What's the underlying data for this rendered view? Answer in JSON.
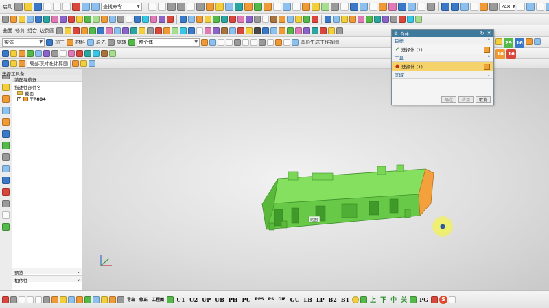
{
  "toolbar1": {
    "menu_label": "启动",
    "command_search_placeholder": "查找命令",
    "zoom_value": "248"
  },
  "toolbar2": {
    "text_items": []
  },
  "toolbar3": {
    "labels": [
      "曲面",
      "修剪",
      "组合",
      "边倒圆"
    ]
  },
  "toolbar4": {
    "selection_filter": "实体",
    "selection_scope": "整个体",
    "labels": [
      "加工",
      "材料",
      "原先",
      "旋转"
    ],
    "right_text": "圆形生成工作视图"
  },
  "toolbar6": {
    "label": "局部项对准计算图"
  },
  "navigator": {
    "header": "选择工具条",
    "title": "装配导航器",
    "root": "描述性部件名",
    "items": [
      {
        "label": "截面",
        "checked": false
      },
      {
        "label": "TP004",
        "checked": true
      }
    ],
    "bottom_rows": [
      "预览",
      "相依性"
    ]
  },
  "dialog": {
    "title": "合并",
    "target_section": "目标",
    "target_select": "选择体 (1)",
    "tool_section": "工具",
    "tool_select": "选择体 (1)",
    "region_section": "区域",
    "buttons": {
      "ok": "确定",
      "apply": "应用",
      "cancel": "取消"
    }
  },
  "viewport": {
    "part_label": "贴图"
  },
  "right_strip": {
    "numbers": [
      "29",
      "16",
      "16",
      "16"
    ]
  },
  "bottombar": {
    "commands": [
      "U1",
      "U2",
      "UP",
      "UB",
      "PH",
      "PU",
      "PPS",
      "PS",
      "DIE",
      "GU",
      "LB",
      "LP",
      "B2",
      "B1"
    ],
    "small_labels": [
      "导出",
      "修正",
      "工程图"
    ],
    "cn_chars": [
      "上",
      "下",
      "中",
      "关"
    ],
    "tail": "PG"
  },
  "colors": {
    "part_green": "#77dd55",
    "part_orange": "#f4a03c",
    "dialog_title": "#3d7a9b",
    "active_row": "#f5d26a"
  }
}
